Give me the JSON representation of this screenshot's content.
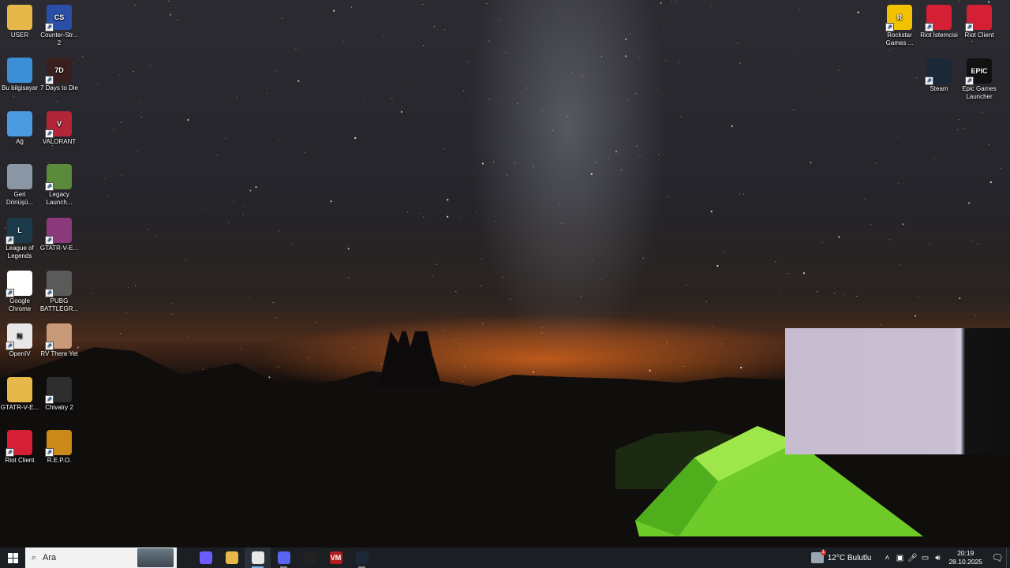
{
  "desktop": {
    "left_icons": [
      {
        "label": "USER",
        "icon": "user-folder-icon",
        "color": "#e6b84a",
        "glyph": "",
        "shortcut": false
      },
      {
        "label": "Counter-Str... 2",
        "icon": "counter-strike-icon",
        "color": "#2a4fa8",
        "glyph": "CS",
        "shortcut": true
      },
      {
        "label": "Bu bilgisayar",
        "icon": "computer-icon",
        "color": "#3a8fd6",
        "glyph": "",
        "shortcut": false
      },
      {
        "label": "7 Days to Die",
        "icon": "seven-days-icon",
        "color": "#3a1f1f",
        "glyph": "7D",
        "shortcut": true
      },
      {
        "label": "Ağ",
        "icon": "network-icon",
        "color": "#4a9be0",
        "glyph": "",
        "shortcut": false
      },
      {
        "label": "VALORANT",
        "icon": "valorant-icon",
        "color": "#b3263a",
        "glyph": "V",
        "shortcut": true
      },
      {
        "label": "Geri Dönüşü...",
        "icon": "recycle-bin-icon",
        "color": "#8a96a3",
        "glyph": "",
        "shortcut": false
      },
      {
        "label": "Legacy Launch...",
        "icon": "minecraft-legacy-icon",
        "color": "#5a8a3a",
        "glyph": "",
        "shortcut": true
      },
      {
        "label": "League of Legends",
        "icon": "league-of-legends-icon",
        "color": "#1b3b4a",
        "glyph": "L",
        "shortcut": true
      },
      {
        "label": "GTATR-V-E...",
        "icon": "winrar-archive-icon",
        "color": "#8a3a7a",
        "glyph": "",
        "shortcut": true
      },
      {
        "label": "Google Chrome",
        "icon": "chrome-icon",
        "color": "#ffffff",
        "glyph": "",
        "shortcut": true
      },
      {
        "label": "PUBG BATTLEGR...",
        "icon": "pubg-icon",
        "color": "#5a5a5a",
        "glyph": "",
        "shortcut": true
      },
      {
        "label": "OpenIV",
        "icon": "openiv-icon",
        "color": "#e8e8e8",
        "glyph": "N",
        "shortcut": true
      },
      {
        "label": "RV There Yet",
        "icon": "rv-there-yet-icon",
        "color": "#c99a7a",
        "glyph": "",
        "shortcut": true
      },
      {
        "label": "GTATR-V-E...",
        "icon": "folder-icon",
        "color": "#e6b84a",
        "glyph": "",
        "shortcut": false
      },
      {
        "label": "Chivalry 2",
        "icon": "chivalry-icon",
        "color": "#2e2e2e",
        "glyph": "",
        "shortcut": true
      },
      {
        "label": "Riot Client",
        "icon": "riot-client-icon",
        "color": "#d41f35",
        "glyph": "",
        "shortcut": true
      },
      {
        "label": "R.E.P.O.",
        "icon": "repo-icon",
        "color": "#c98a1a",
        "glyph": "",
        "shortcut": true
      }
    ],
    "right_icons": [
      {
        "label": "Rockstar Games ...",
        "icon": "rockstar-icon",
        "color": "#f2c200",
        "glyph": "R",
        "shortcut": true
      },
      {
        "label": "Riot İstemcisi",
        "icon": "riot-istemcisi-icon",
        "color": "#d41f35",
        "glyph": "",
        "shortcut": true
      },
      {
        "label": "Riot Client",
        "icon": "riot-client-icon",
        "color": "#d41f35",
        "glyph": "",
        "shortcut": true
      },
      {
        "label": "Steam",
        "icon": "steam-icon",
        "color": "#1b2838",
        "glyph": "",
        "shortcut": true
      },
      {
        "label": "Epic Games Launcher",
        "icon": "epic-games-icon",
        "color": "#111111",
        "glyph": "EPIC",
        "shortcut": true
      }
    ]
  },
  "taskbar": {
    "search_placeholder": "Ara",
    "apps": [
      {
        "name": "copilot",
        "icon": "copilot-icon",
        "color": "#6a5cff",
        "glyph": "",
        "state": "none"
      },
      {
        "name": "file-explorer",
        "icon": "folder-icon",
        "color": "#e6b84a",
        "glyph": "",
        "state": "none"
      },
      {
        "name": "chrome",
        "icon": "chrome-icon",
        "color": "#e8e8e8",
        "glyph": "",
        "state": "active"
      },
      {
        "name": "discord",
        "icon": "discord-icon",
        "color": "#5865f2",
        "glyph": "",
        "state": "open"
      },
      {
        "name": "capture-tool",
        "icon": "recording-icon",
        "color": "#222222",
        "glyph": "",
        "state": "none"
      },
      {
        "name": "voicemeeter",
        "icon": "voicemeeter-icon",
        "color": "#b01e1e",
        "glyph": "VM",
        "state": "none"
      },
      {
        "name": "steam",
        "icon": "steam-icon",
        "color": "#1b2838",
        "glyph": "",
        "state": "open"
      }
    ],
    "weather": {
      "temp": "12°C",
      "condition": "Bulutlu",
      "badge": "1"
    },
    "time": "20:19",
    "date": "28.10.2025"
  }
}
